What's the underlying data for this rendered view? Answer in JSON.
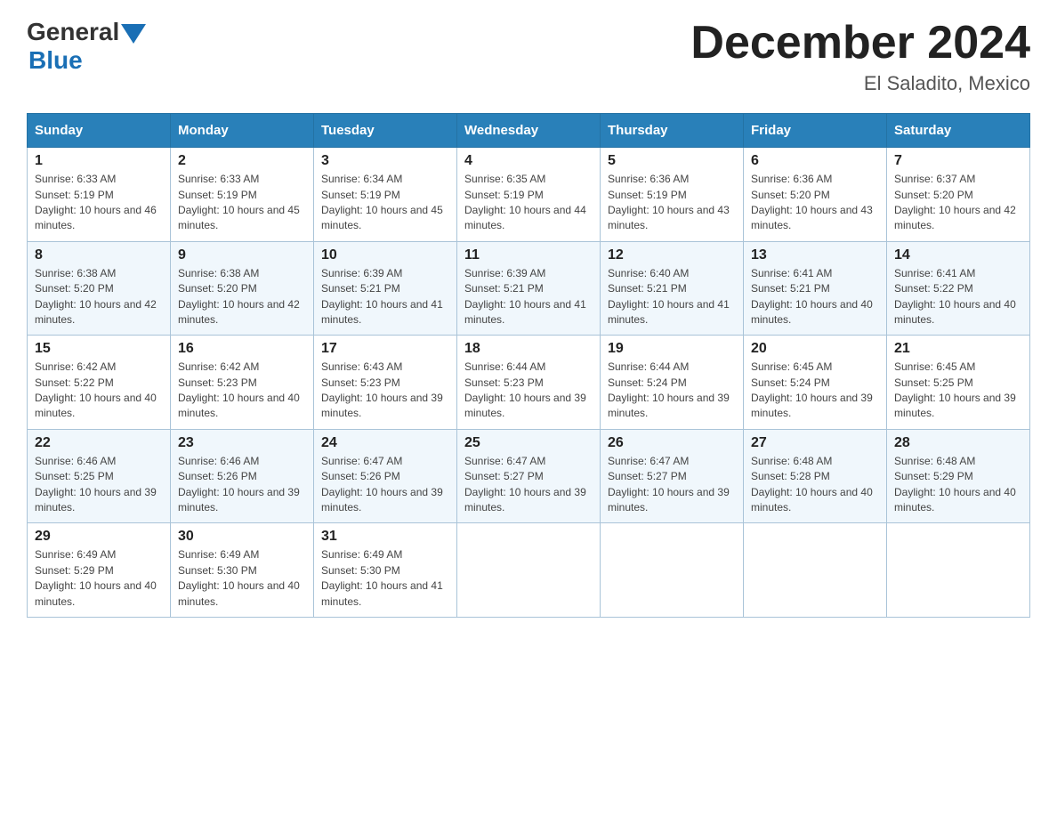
{
  "header": {
    "logo_general": "General",
    "logo_blue": "Blue",
    "month_year": "December 2024",
    "location": "El Saladito, Mexico"
  },
  "days_of_week": [
    "Sunday",
    "Monday",
    "Tuesday",
    "Wednesday",
    "Thursday",
    "Friday",
    "Saturday"
  ],
  "weeks": [
    [
      {
        "day": "1",
        "sunrise": "6:33 AM",
        "sunset": "5:19 PM",
        "daylight": "10 hours and 46 minutes."
      },
      {
        "day": "2",
        "sunrise": "6:33 AM",
        "sunset": "5:19 PM",
        "daylight": "10 hours and 45 minutes."
      },
      {
        "day": "3",
        "sunrise": "6:34 AM",
        "sunset": "5:19 PM",
        "daylight": "10 hours and 45 minutes."
      },
      {
        "day": "4",
        "sunrise": "6:35 AM",
        "sunset": "5:19 PM",
        "daylight": "10 hours and 44 minutes."
      },
      {
        "day": "5",
        "sunrise": "6:36 AM",
        "sunset": "5:19 PM",
        "daylight": "10 hours and 43 minutes."
      },
      {
        "day": "6",
        "sunrise": "6:36 AM",
        "sunset": "5:20 PM",
        "daylight": "10 hours and 43 minutes."
      },
      {
        "day": "7",
        "sunrise": "6:37 AM",
        "sunset": "5:20 PM",
        "daylight": "10 hours and 42 minutes."
      }
    ],
    [
      {
        "day": "8",
        "sunrise": "6:38 AM",
        "sunset": "5:20 PM",
        "daylight": "10 hours and 42 minutes."
      },
      {
        "day": "9",
        "sunrise": "6:38 AM",
        "sunset": "5:20 PM",
        "daylight": "10 hours and 42 minutes."
      },
      {
        "day": "10",
        "sunrise": "6:39 AM",
        "sunset": "5:21 PM",
        "daylight": "10 hours and 41 minutes."
      },
      {
        "day": "11",
        "sunrise": "6:39 AM",
        "sunset": "5:21 PM",
        "daylight": "10 hours and 41 minutes."
      },
      {
        "day": "12",
        "sunrise": "6:40 AM",
        "sunset": "5:21 PM",
        "daylight": "10 hours and 41 minutes."
      },
      {
        "day": "13",
        "sunrise": "6:41 AM",
        "sunset": "5:21 PM",
        "daylight": "10 hours and 40 minutes."
      },
      {
        "day": "14",
        "sunrise": "6:41 AM",
        "sunset": "5:22 PM",
        "daylight": "10 hours and 40 minutes."
      }
    ],
    [
      {
        "day": "15",
        "sunrise": "6:42 AM",
        "sunset": "5:22 PM",
        "daylight": "10 hours and 40 minutes."
      },
      {
        "day": "16",
        "sunrise": "6:42 AM",
        "sunset": "5:23 PM",
        "daylight": "10 hours and 40 minutes."
      },
      {
        "day": "17",
        "sunrise": "6:43 AM",
        "sunset": "5:23 PM",
        "daylight": "10 hours and 39 minutes."
      },
      {
        "day": "18",
        "sunrise": "6:44 AM",
        "sunset": "5:23 PM",
        "daylight": "10 hours and 39 minutes."
      },
      {
        "day": "19",
        "sunrise": "6:44 AM",
        "sunset": "5:24 PM",
        "daylight": "10 hours and 39 minutes."
      },
      {
        "day": "20",
        "sunrise": "6:45 AM",
        "sunset": "5:24 PM",
        "daylight": "10 hours and 39 minutes."
      },
      {
        "day": "21",
        "sunrise": "6:45 AM",
        "sunset": "5:25 PM",
        "daylight": "10 hours and 39 minutes."
      }
    ],
    [
      {
        "day": "22",
        "sunrise": "6:46 AM",
        "sunset": "5:25 PM",
        "daylight": "10 hours and 39 minutes."
      },
      {
        "day": "23",
        "sunrise": "6:46 AM",
        "sunset": "5:26 PM",
        "daylight": "10 hours and 39 minutes."
      },
      {
        "day": "24",
        "sunrise": "6:47 AM",
        "sunset": "5:26 PM",
        "daylight": "10 hours and 39 minutes."
      },
      {
        "day": "25",
        "sunrise": "6:47 AM",
        "sunset": "5:27 PM",
        "daylight": "10 hours and 39 minutes."
      },
      {
        "day": "26",
        "sunrise": "6:47 AM",
        "sunset": "5:27 PM",
        "daylight": "10 hours and 39 minutes."
      },
      {
        "day": "27",
        "sunrise": "6:48 AM",
        "sunset": "5:28 PM",
        "daylight": "10 hours and 40 minutes."
      },
      {
        "day": "28",
        "sunrise": "6:48 AM",
        "sunset": "5:29 PM",
        "daylight": "10 hours and 40 minutes."
      }
    ],
    [
      {
        "day": "29",
        "sunrise": "6:49 AM",
        "sunset": "5:29 PM",
        "daylight": "10 hours and 40 minutes."
      },
      {
        "day": "30",
        "sunrise": "6:49 AM",
        "sunset": "5:30 PM",
        "daylight": "10 hours and 40 minutes."
      },
      {
        "day": "31",
        "sunrise": "6:49 AM",
        "sunset": "5:30 PM",
        "daylight": "10 hours and 41 minutes."
      },
      null,
      null,
      null,
      null
    ]
  ],
  "labels": {
    "sunrise_prefix": "Sunrise: ",
    "sunset_prefix": "Sunset: ",
    "daylight_prefix": "Daylight: "
  }
}
